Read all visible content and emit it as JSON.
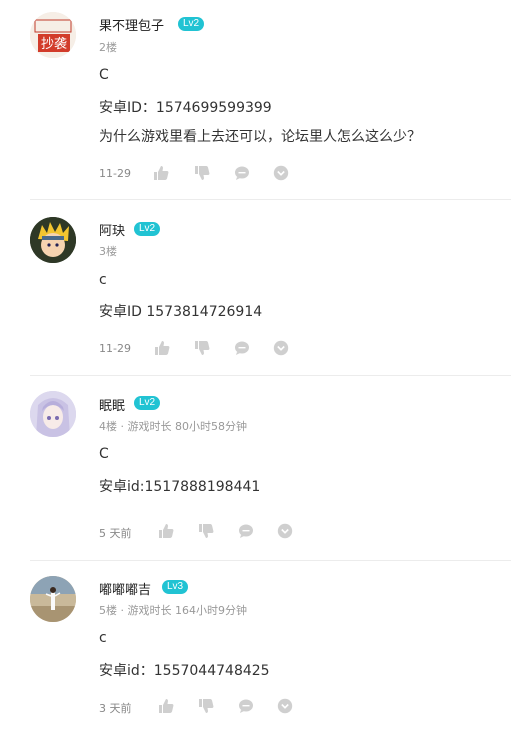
{
  "posts": [
    {
      "name": "果不理包子",
      "level": "Lv2",
      "floor": "2楼",
      "lines": [
        "C",
        "安卓ID：1574699599399",
        "为什么游戏里看上去还可以，论坛里人怎么这么少？"
      ],
      "time": "11-29",
      "avatar_icon": "stamp-avatar",
      "avatar_text": "抄袭"
    },
    {
      "name": "阿玦",
      "level": "Lv2",
      "floor": "3楼",
      "lines": [
        "c",
        "安卓ID 1573814726914"
      ],
      "time": "11-29",
      "avatar_icon": "anime-boy-avatar"
    },
    {
      "name": "眠眠",
      "level": "Lv2",
      "floor": "4楼 · 游戏时长 80小时58分钟",
      "lines": [
        "C",
        "安卓id:1517888198441"
      ],
      "time": "5 天前",
      "avatar_icon": "anime-girl-avatar"
    },
    {
      "name": "嘟嘟嘟吉",
      "level": "Lv3",
      "floor": "5楼 · 游戏时长 164小时9分钟",
      "lines": [
        "c",
        "安卓id：1557044748425"
      ],
      "time": "3 天前",
      "avatar_icon": "photo-avatar"
    }
  ],
  "actions": [
    "thumb-up-icon",
    "thumb-down-icon",
    "comment-icon",
    "more-icon"
  ],
  "colors": {
    "badge": "#21c3d3",
    "icon": "#cfcfcf"
  }
}
